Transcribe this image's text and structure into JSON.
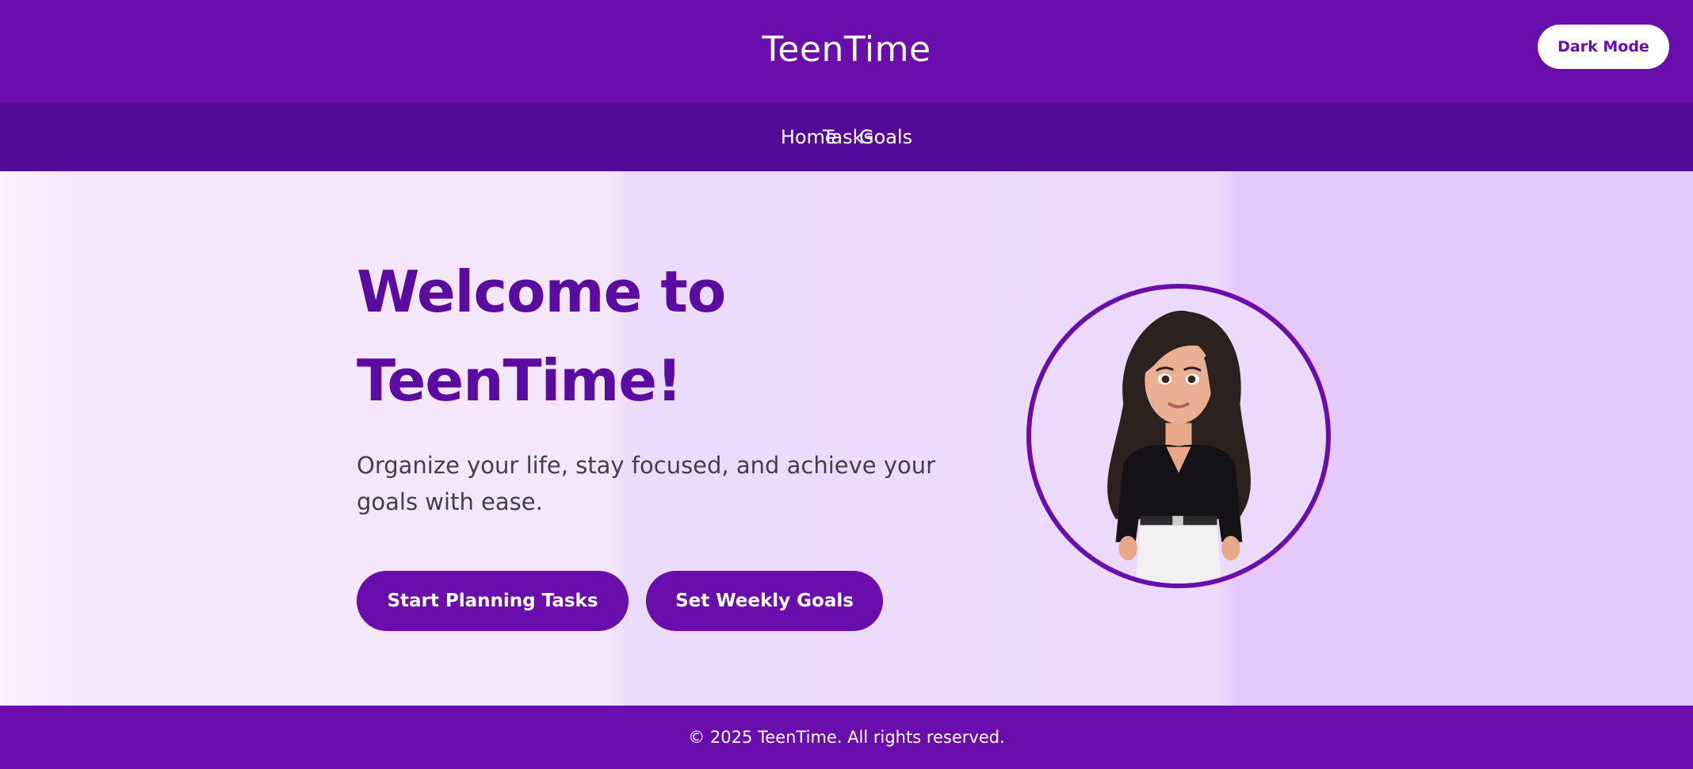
{
  "header": {
    "title": "TeenTime",
    "dark_mode_label": "Dark Mode"
  },
  "nav": {
    "items": [
      {
        "label": "Home"
      },
      {
        "label": "Tasks"
      },
      {
        "label": "Goals"
      }
    ]
  },
  "hero": {
    "title_line1": "Welcome to",
    "title_line2": "TeenTime!",
    "subtitle": "Organize your life, stay focused, and achieve your goals with ease.",
    "primary_button": "Start Planning Tasks",
    "secondary_button": "Set Weekly Goals",
    "avatar_icon": "avatar-illustration"
  },
  "footer": {
    "copyright": "© 2025 TeenTime. All rights reserved."
  },
  "colors": {
    "brand_purple": "#6a0dad",
    "nav_purple": "#510b96",
    "heading_purple": "#5a0ba0"
  }
}
